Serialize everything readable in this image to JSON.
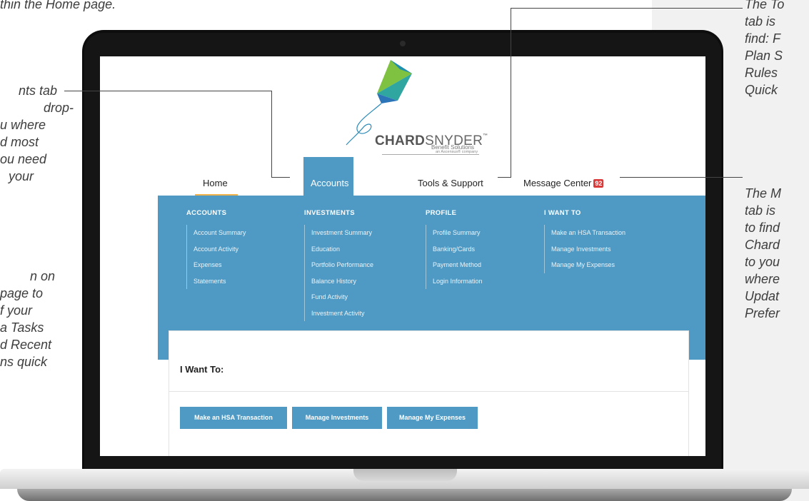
{
  "annotations": {
    "top_left": "thin the Home page.",
    "accounts_tab": [
      "nts tab",
      "drop-",
      "u where",
      "d most",
      "ou need",
      "your"
    ],
    "home_page": [
      "n on",
      "page to",
      "f your",
      "a Tasks",
      "d Recent",
      "ns quick"
    ],
    "tools_tab": [
      "The To",
      "tab is",
      "find: F",
      "Plan S",
      "Rules",
      "Quick"
    ],
    "message_center_tab": [
      "The M",
      "tab is",
      "to find",
      "Chard",
      "to you",
      "where",
      "Updat",
      "Prefer"
    ]
  },
  "brand": {
    "name_bold": "CHARD",
    "name_light": "SNYDER",
    "trademark": "™",
    "tagline": "Benefit Solutions",
    "parent": "an Ascensus® company"
  },
  "nav": {
    "home": "Home",
    "accounts": "Accounts",
    "tools": "Tools & Support",
    "messages": "Message Center",
    "message_count": "92"
  },
  "menu": {
    "columns": [
      {
        "heading": "ACCOUNTS",
        "items": [
          "Account Summary",
          "Account Activity",
          "Expenses",
          "Statements"
        ]
      },
      {
        "heading": "INVESTMENTS",
        "items": [
          "Investment Summary",
          "Education",
          "Portfolio Performance",
          "Balance History",
          "Fund Activity",
          "Investment Activity"
        ]
      },
      {
        "heading": "PROFILE",
        "items": [
          "Profile Summary",
          "Banking/Cards",
          "Payment Method",
          "Login Information"
        ]
      },
      {
        "heading": "I WANT TO",
        "items": [
          "Make an HSA Transaction",
          "Manage Investments",
          "Manage My Expenses"
        ]
      }
    ]
  },
  "i_want_to": {
    "title": "I Want To:",
    "buttons": [
      "Make an HSA Transaction",
      "Manage Investments",
      "Manage My Expenses"
    ]
  },
  "colors": {
    "accent": "#4f9ac4",
    "home_underline": "#f0b24b",
    "badge": "#d93a3a"
  }
}
